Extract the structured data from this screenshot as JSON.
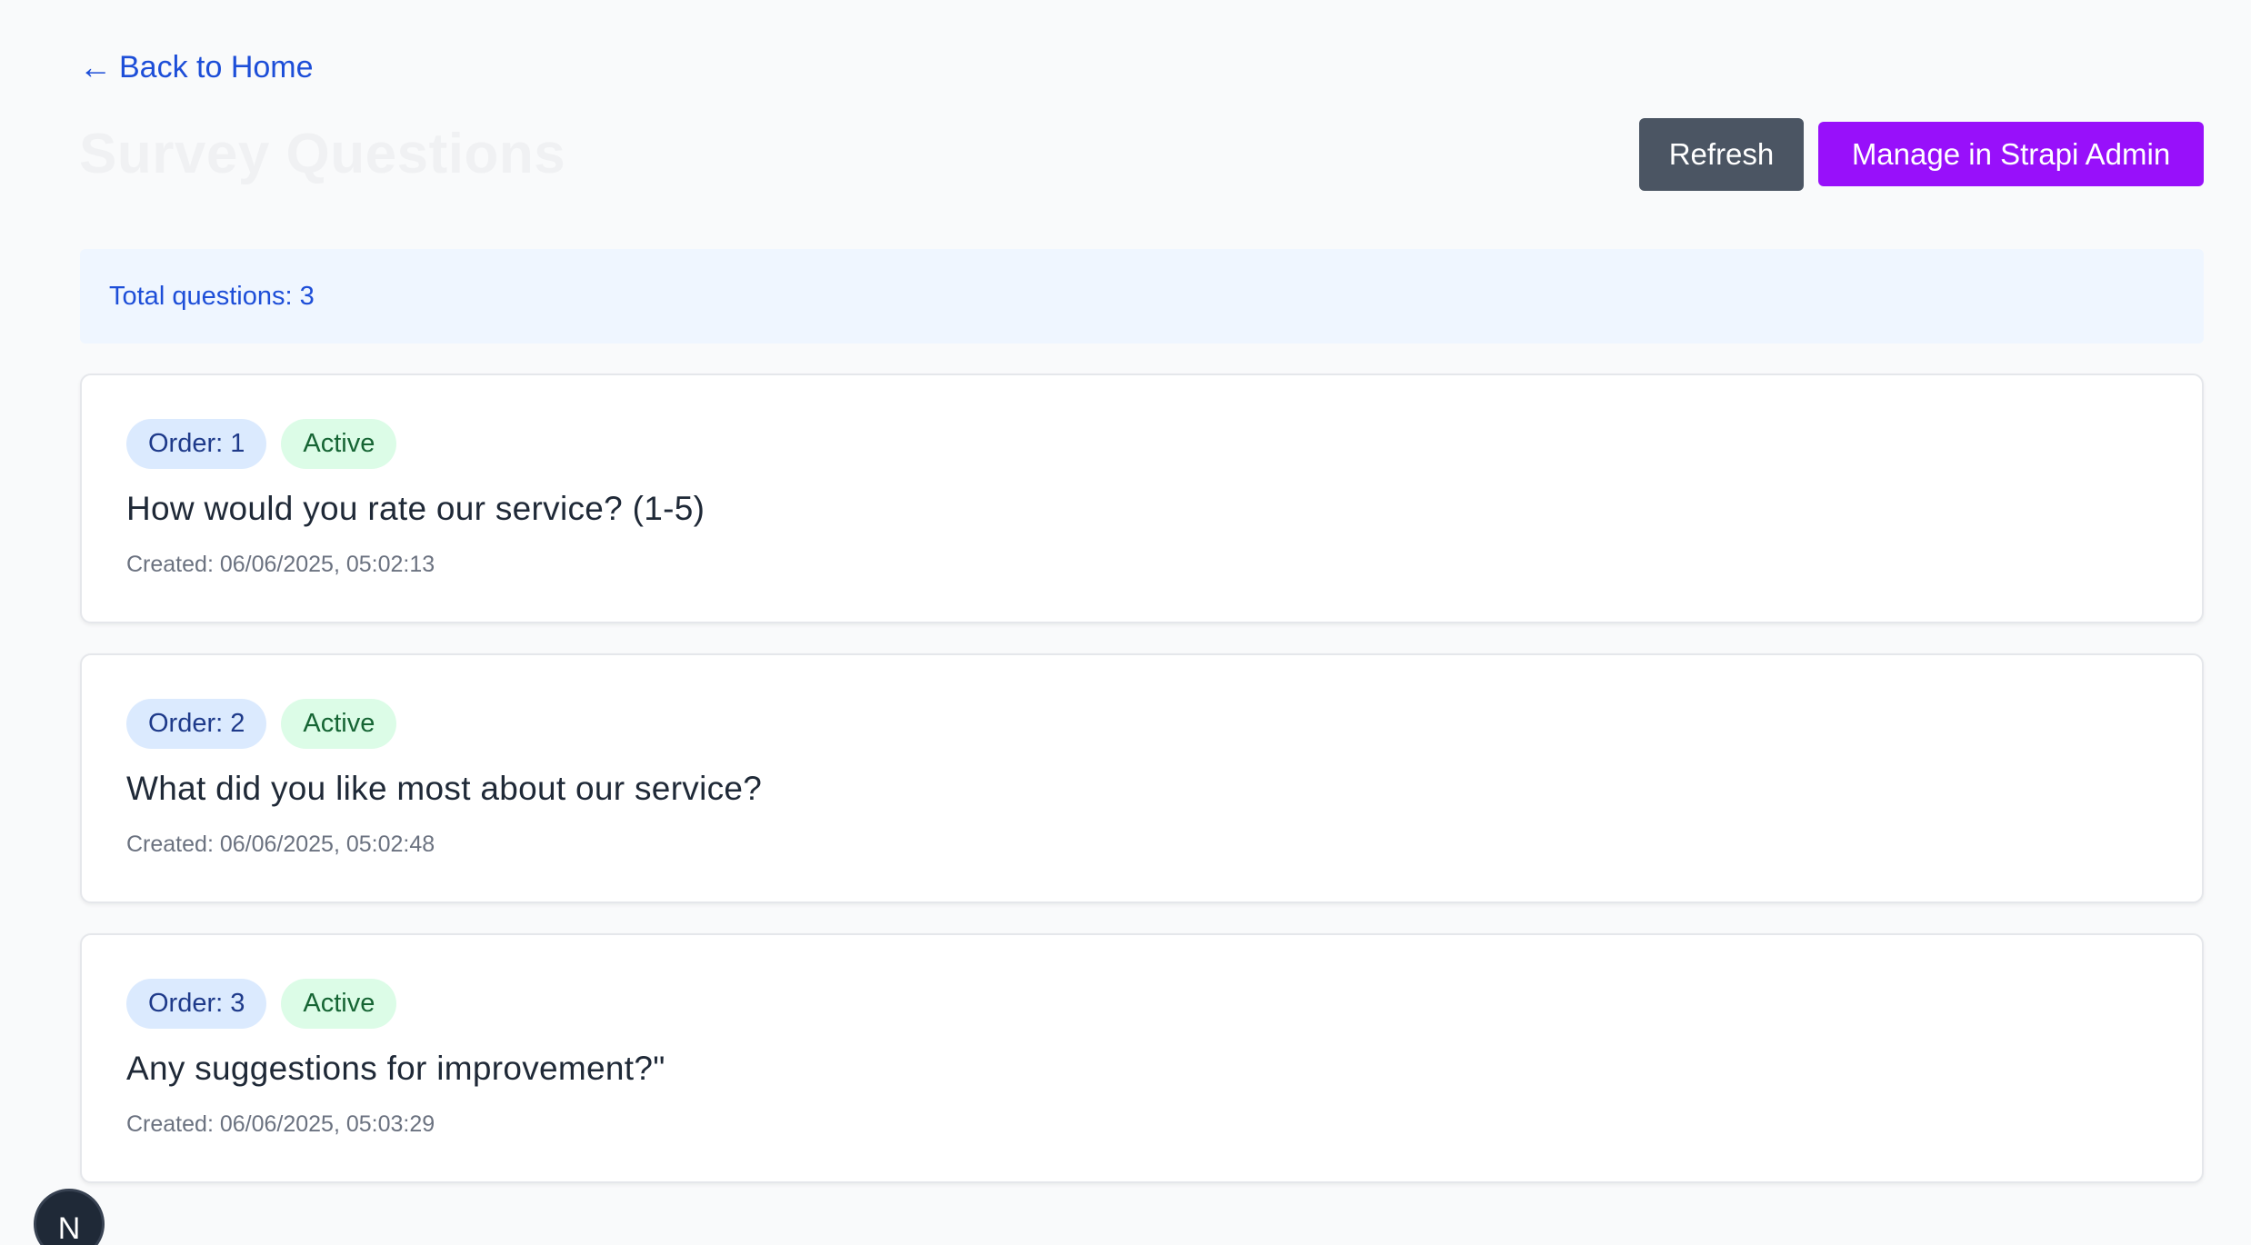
{
  "nav": {
    "back_arrow": "←",
    "back_label": "Back to Home"
  },
  "header": {
    "title": "Survey Questions",
    "refresh_label": "Refresh",
    "admin_label": "Manage in Strapi Admin"
  },
  "summary": {
    "total_text": "Total questions: 3"
  },
  "questions": [
    {
      "order": "Order: 1",
      "status": "Active",
      "text": "How would you rate our service? (1-5)",
      "created": "Created: 06/06/2025, 05:02:13"
    },
    {
      "order": "Order: 2",
      "status": "Active",
      "text": "What did you like most about our service?",
      "created": "Created: 06/06/2025, 05:02:48"
    },
    {
      "order": "Order: 3",
      "status": "Active",
      "text": "Any suggestions for improvement?\"",
      "created": "Created: 06/06/2025, 05:03:29"
    }
  ],
  "dev_indicator": {
    "letter": "N",
    "icon": "nextjs-logo-icon"
  },
  "colors": {
    "link": "#1d4ed8",
    "refresh_button": "#4b5563",
    "admin_button": "#9810fa",
    "banner_bg": "#eff6ff",
    "order_badge_bg": "#dbeafe",
    "active_badge_bg": "#dcfce7"
  }
}
